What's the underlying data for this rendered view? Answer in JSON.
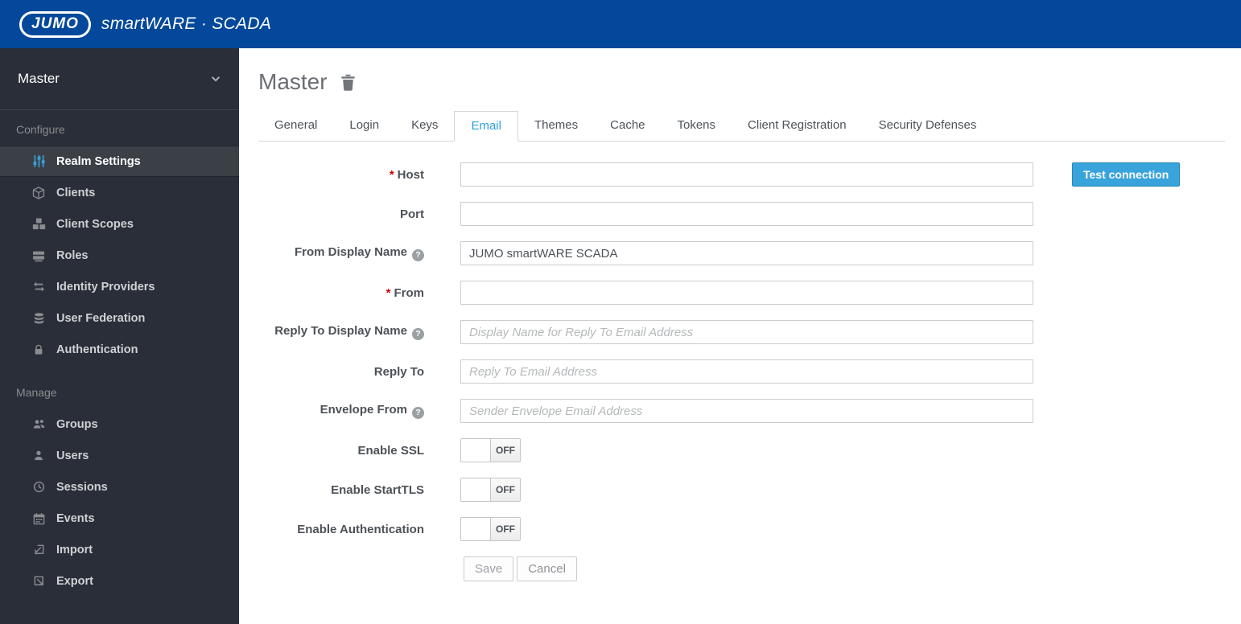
{
  "header": {
    "logo_text": "JUMO",
    "product_name": "smartWARE · SCADA"
  },
  "sidebar": {
    "realm_selector": "Master",
    "sections": [
      {
        "label": "Configure",
        "items": [
          {
            "label": "Realm Settings",
            "icon": "sliders-icon",
            "active": true
          },
          {
            "label": "Clients",
            "icon": "cube-icon",
            "active": false
          },
          {
            "label": "Client Scopes",
            "icon": "cubes-icon",
            "active": false
          },
          {
            "label": "Roles",
            "icon": "list-icon",
            "active": false
          },
          {
            "label": "Identity Providers",
            "icon": "exchange-arrows-icon",
            "active": false
          },
          {
            "label": "User Federation",
            "icon": "database-icon",
            "active": false
          },
          {
            "label": "Authentication",
            "icon": "lock-icon",
            "active": false
          }
        ]
      },
      {
        "label": "Manage",
        "items": [
          {
            "label": "Groups",
            "icon": "group-icon",
            "active": false
          },
          {
            "label": "Users",
            "icon": "user-icon",
            "active": false
          },
          {
            "label": "Sessions",
            "icon": "clock-icon",
            "active": false
          },
          {
            "label": "Events",
            "icon": "calendar-icon",
            "active": false
          },
          {
            "label": "Import",
            "icon": "import-icon",
            "active": false
          },
          {
            "label": "Export",
            "icon": "export-icon",
            "active": false
          }
        ]
      }
    ]
  },
  "main": {
    "page_title": "Master",
    "tabs": [
      {
        "label": "General",
        "active": false
      },
      {
        "label": "Login",
        "active": false
      },
      {
        "label": "Keys",
        "active": false
      },
      {
        "label": "Email",
        "active": true
      },
      {
        "label": "Themes",
        "active": false
      },
      {
        "label": "Cache",
        "active": false
      },
      {
        "label": "Tokens",
        "active": false
      },
      {
        "label": "Client Registration",
        "active": false
      },
      {
        "label": "Security Defenses",
        "active": false
      }
    ],
    "form": {
      "required_marker": "*",
      "help_marker": "?",
      "fields": [
        {
          "label": "Host",
          "required": true,
          "help": false,
          "value": "",
          "placeholder": ""
        },
        {
          "label": "Port",
          "required": false,
          "help": false,
          "value": "",
          "placeholder": ""
        },
        {
          "label": "From Display Name",
          "required": false,
          "help": true,
          "value": "JUMO smartWARE SCADA",
          "placeholder": ""
        },
        {
          "label": "From",
          "required": true,
          "help": false,
          "value": "",
          "placeholder": ""
        },
        {
          "label": "Reply To Display Name",
          "required": false,
          "help": true,
          "value": "",
          "placeholder": "Display Name for Reply To Email Address"
        },
        {
          "label": "Reply To",
          "required": false,
          "help": false,
          "value": "",
          "placeholder": "Reply To Email Address"
        },
        {
          "label": "Envelope From",
          "required": false,
          "help": true,
          "value": "",
          "placeholder": "Sender Envelope Email Address"
        }
      ],
      "toggles": [
        {
          "label": "Enable SSL",
          "state": "OFF"
        },
        {
          "label": "Enable StartTLS",
          "state": "OFF"
        },
        {
          "label": "Enable Authentication",
          "state": "OFF"
        }
      ],
      "test_connection_label": "Test connection",
      "save_label": "Save",
      "cancel_label": "Cancel"
    }
  },
  "colors": {
    "header_bg": "#04489B",
    "sidebar_bg": "#292E38",
    "active_nav_icon": "#3AA2DB",
    "active_tab_text": "#2E9FDB",
    "primary_button_bg": "#39A3DC",
    "required_red": "#CC0000"
  }
}
